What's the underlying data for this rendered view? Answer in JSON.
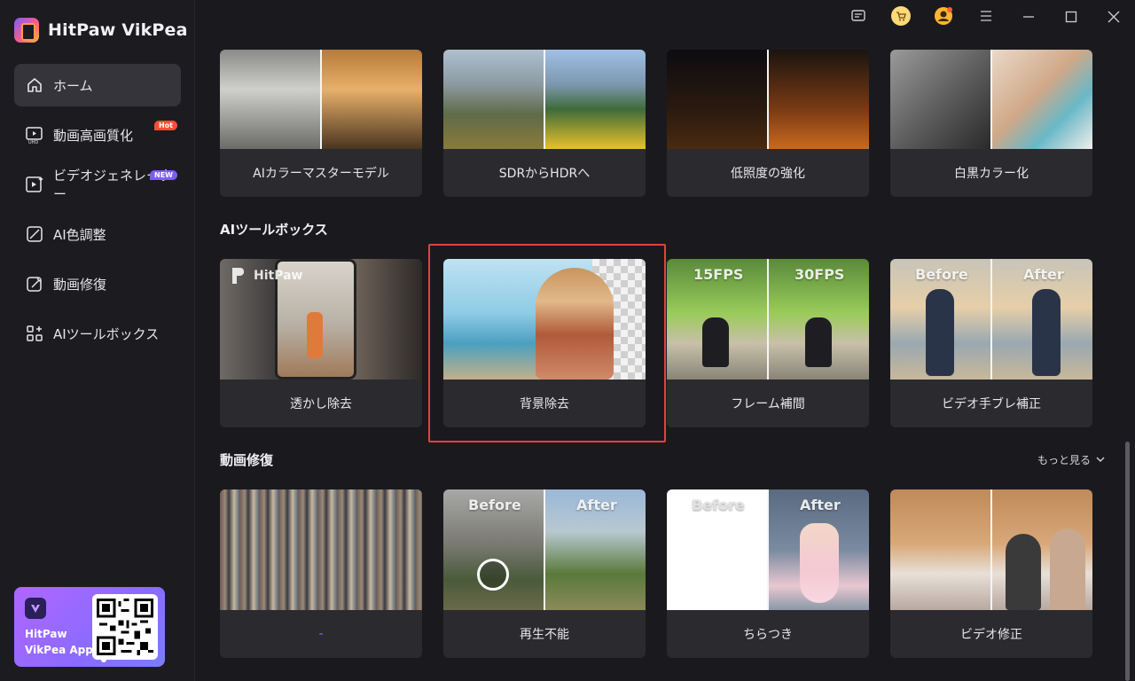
{
  "app": {
    "name": "HitPaw VikPea"
  },
  "sidebar": {
    "items": [
      {
        "label": "ホーム",
        "icon": "home-icon",
        "active": true
      },
      {
        "label": "動画高画質化",
        "icon": "uhd-video-icon",
        "badge": "Hot"
      },
      {
        "label": "ビデオジェネレーター",
        "icon": "video-generator-icon",
        "badge": "NEW"
      },
      {
        "label": "AI色調整",
        "icon": "color-adjust-icon"
      },
      {
        "label": "動画修復",
        "icon": "video-repair-icon"
      },
      {
        "label": "AIツールボックス",
        "icon": "toolbox-icon"
      }
    ],
    "promo": {
      "title": "HitPaw VikPea App"
    }
  },
  "topbar": {
    "icons": [
      "feedback-icon",
      "cart-icon",
      "account-icon",
      "menu-icon",
      "minimize-icon",
      "maximize-icon",
      "close-icon"
    ]
  },
  "sections": {
    "top_row": {
      "cards": [
        {
          "label": "AIカラーマスターモデル"
        },
        {
          "label": "SDRからHDRへ"
        },
        {
          "label": "低照度の強化"
        },
        {
          "label": "白黒カラー化"
        }
      ]
    },
    "toolbox": {
      "title": "AIツールボックス",
      "cards": [
        {
          "label": "透かし除去",
          "overlay": "HitPaw"
        },
        {
          "label": "背景除去"
        },
        {
          "label": "フレーム補間",
          "before": "15FPS",
          "after": "30FPS"
        },
        {
          "label": "ビデオ手ブレ補正",
          "before": "Before",
          "after": "After"
        }
      ]
    },
    "repair": {
      "title": "動画修復",
      "more": "もっと見る",
      "cards": [
        {
          "label": "-"
        },
        {
          "label": "再生不能",
          "before": "Before",
          "after": "After"
        },
        {
          "label": "ちらつき",
          "before": "Before",
          "after": "After"
        },
        {
          "label": "ビデオ修正"
        }
      ]
    }
  },
  "colors": {
    "accent": "#7d5cff",
    "highlight": "#e0443b",
    "hot": "#ff4d3a"
  }
}
